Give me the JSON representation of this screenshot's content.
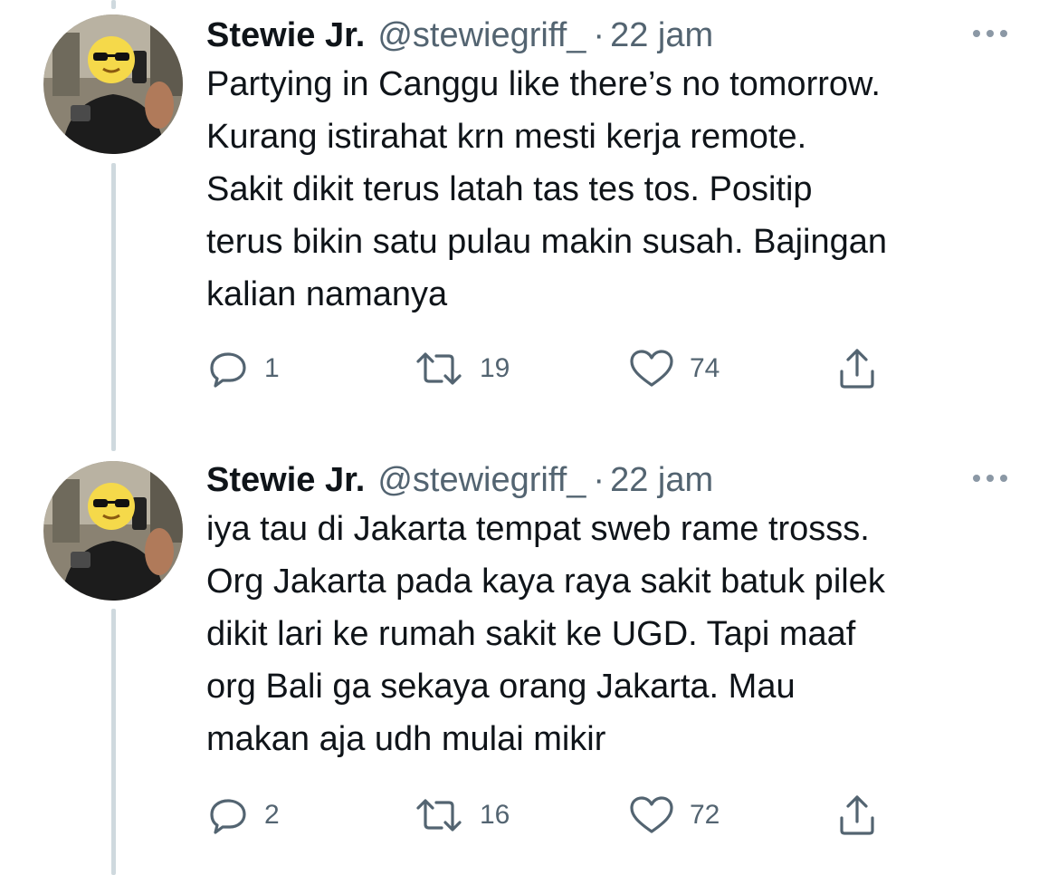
{
  "tweets": [
    {
      "author_name": "Stewie Jr.",
      "handle": "@stewiegriff_",
      "separator": "·",
      "time": "22 jam",
      "lines": [
        "Partying in Canggu like there’s no tomorrow.",
        "Kurang istirahat krn mesti kerja remote.",
        "Sakit dikit terus latah tas tes tos. Positip",
        "terus bikin satu pulau makin susah. Bajingan",
        "kalian namanya"
      ],
      "replies": "1",
      "retweets": "19",
      "likes": "74"
    },
    {
      "author_name": "Stewie Jr.",
      "handle": "@stewiegriff_",
      "separator": "·",
      "time": "22 jam",
      "lines": [
        "iya tau di Jakarta tempat sweb rame trosss.",
        "Org Jakarta pada kaya raya sakit batuk pilek",
        "dikit lari ke rumah sakit ke UGD. Tapi maaf",
        "org Bali ga sekaya orang Jakarta. Mau",
        "makan aja udh mulai mikir"
      ],
      "replies": "2",
      "retweets": "16",
      "likes": "72"
    }
  ],
  "icons": {
    "reply": "reply-icon",
    "retweet": "retweet-icon",
    "like": "heart-icon",
    "share": "share-icon",
    "more": "more-icon"
  },
  "colors": {
    "text_primary": "#0f1419",
    "text_secondary": "#536471",
    "thread_line": "#cfd9de"
  }
}
